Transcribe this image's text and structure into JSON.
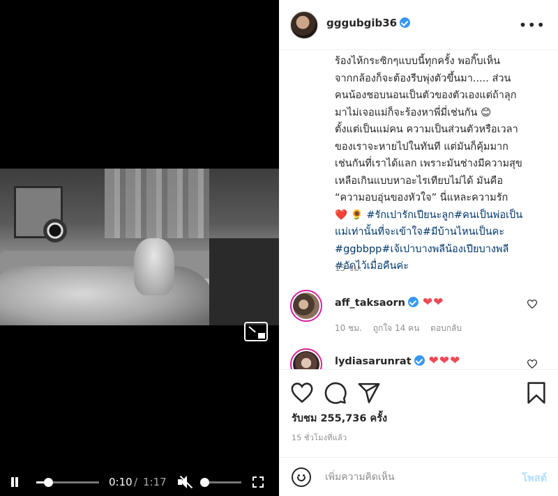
{
  "video": {
    "current_time": "0:10",
    "separator": "/",
    "total_time": "1:17",
    "progress_fraction": 0.19,
    "volume_fraction": 0.05,
    "muted": true
  },
  "post": {
    "author": "gggubgib36",
    "caption_lines": [
      "ร้องไห้กระซิกๆแบบนี้ทุกครั้ง พอกิ๊บเห็น",
      "จากกล้องก็จะต้องรีบพุ่งตัวขึ้นมา..... ส่วน",
      "คนน้องชอบนอนเป็นตัวของตัวเองแต่ถ้าลุก",
      "มาไม่เจอแม่ก็จะร้องหาพี่มี่เช่นกัน 😊",
      "ตั้งแต่เป็นแม่คน ความเป็นส่วนตัวหรือเวลา",
      "ของเราจะหายไปในทันที แต่มันก็คุ้มมาก",
      "เช่นกันที่เราได้แลก เพราะมันช่างมีความสุข",
      "เหลือเกินแบบหาอะไรเทียบไม่ได้ มันคือ",
      "“ความอบอุ่นของหัวใจ” นี่แหละความรัก"
    ],
    "caption_emojis": "❤️ 🌻",
    "hashtag_lines": [
      "#รักเปารักเปียนะลูก#คนเป็นพ่อเป็น",
      "แม่เท่านั้นที่จะเข้าใจ#มีบ้านไหนเป็นคะ",
      "#ggbbpp#เจ้เปาบางพลีน้องเปียบางพลี",
      "#อัดไว้เมื่อคืนค่ะ"
    ],
    "caption_time": "15 ชม.",
    "views_label": "รับชม 255,736 ครั้ง",
    "post_time": "15 ชั่วโมงที่แล้ว"
  },
  "comments": [
    {
      "username": "aff_taksaorn",
      "text": "❤❤",
      "time": "10 ชม.",
      "likes": "ถูกใจ 14 คน",
      "reply": "ตอบกลับ"
    },
    {
      "username": "lydiasarunrat",
      "text": "❤❤❤"
    }
  ],
  "comment_box": {
    "placeholder": "เพิ่มความคิดเห็น",
    "post_label": "โพสต์"
  },
  "colors": {
    "verified": "#3897f0",
    "hashtag": "#00376b",
    "heart": "#ed4956",
    "post_disabled": "#b2dffc"
  },
  "icons": [
    "pause-icon",
    "mute-icon",
    "fullscreen-icon",
    "pip-icon",
    "verified-icon",
    "more-icon",
    "heart-icon",
    "comment-icon",
    "share-icon",
    "bookmark-icon",
    "smiley-icon"
  ]
}
